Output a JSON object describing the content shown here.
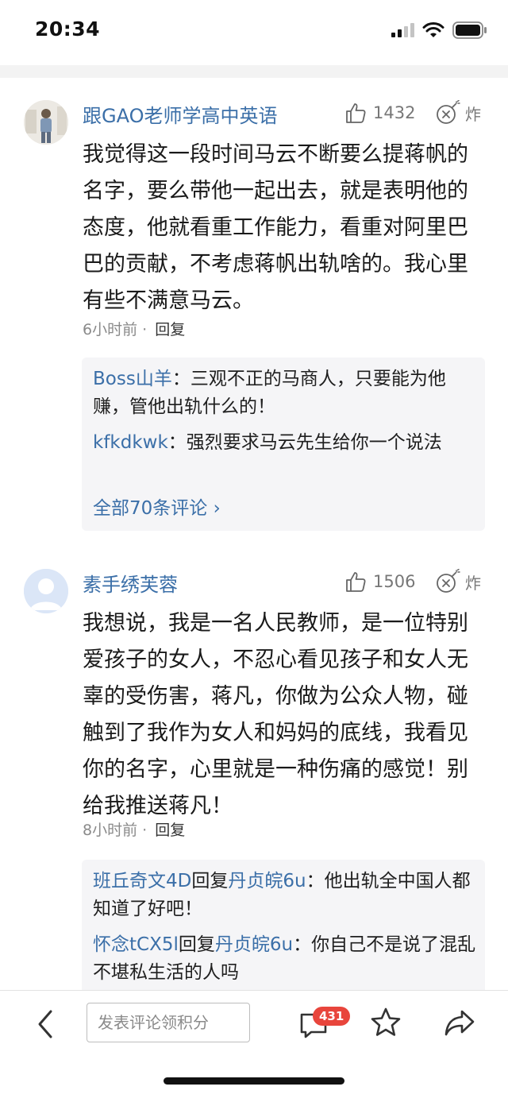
{
  "status_bar": {
    "time": "20:34",
    "icons": [
      "signal-icon",
      "wifi-icon",
      "battery-icon"
    ]
  },
  "comments": [
    {
      "author": "跟GAO老师学高中英语",
      "avatar": "photo-avatar",
      "likes": "1432",
      "bomb_label": "炸",
      "text": "我觉得这一段时间马云不断要么提蒋帆的名字，要么带他一起出去，就是表明他的态度，他就看重工作能力，看重对阿里巴巴的贡献，不考虑蒋帆出轨啥的。我心里有些不满意马云。",
      "time": "6小时前",
      "separator": "·",
      "reply_label": "回复",
      "replies": [
        {
          "user": "Boss山羊",
          "text": "：三观不正的马商人，只要能为他赚，管他出轨什么的！"
        },
        {
          "user": "kfkdkwk",
          "text": "：强烈要求马云先生给你一个说法"
        }
      ],
      "all_replies": "全部70条评论 ›"
    },
    {
      "author": "素手绣芙蓉",
      "avatar": "default-avatar",
      "likes": "1506",
      "bomb_label": "炸",
      "text": "我想说，我是一名人民教师，是一位特别爱孩子的女人，不忍心看见孩子和女人无辜的受伤害，蒋凡，你做为公众人物，碰触到了我作为女人和妈妈的底线，我看见你的名字，心里就是一种伤痛的感觉！别给我推送蒋凡！",
      "time": "8小时前",
      "separator": "·",
      "reply_label": "回复",
      "replies": [
        {
          "user": "班丘奇文4D",
          "reply_word": "回复",
          "target": "丹贞皖6u",
          "text": "：他出轨全中国人都知道了好吧！"
        },
        {
          "user": "怀念tCX5l",
          "reply_word": "回复",
          "target": "丹贞皖6u",
          "text": "：你自己不是说了混乱不堪私生活的人吗"
        }
      ]
    }
  ],
  "bottom_bar": {
    "input_placeholder": "发表评论领积分",
    "comment_count": "431",
    "icons": [
      "back-arrow-icon",
      "comment-bubble-icon",
      "star-icon",
      "share-icon"
    ],
    "badge_color": "#e8453c"
  },
  "colors": {
    "link_blue": "#3b6fa8",
    "meta_gray": "#8a8a8a",
    "reply_bg": "#f5f5f7"
  }
}
